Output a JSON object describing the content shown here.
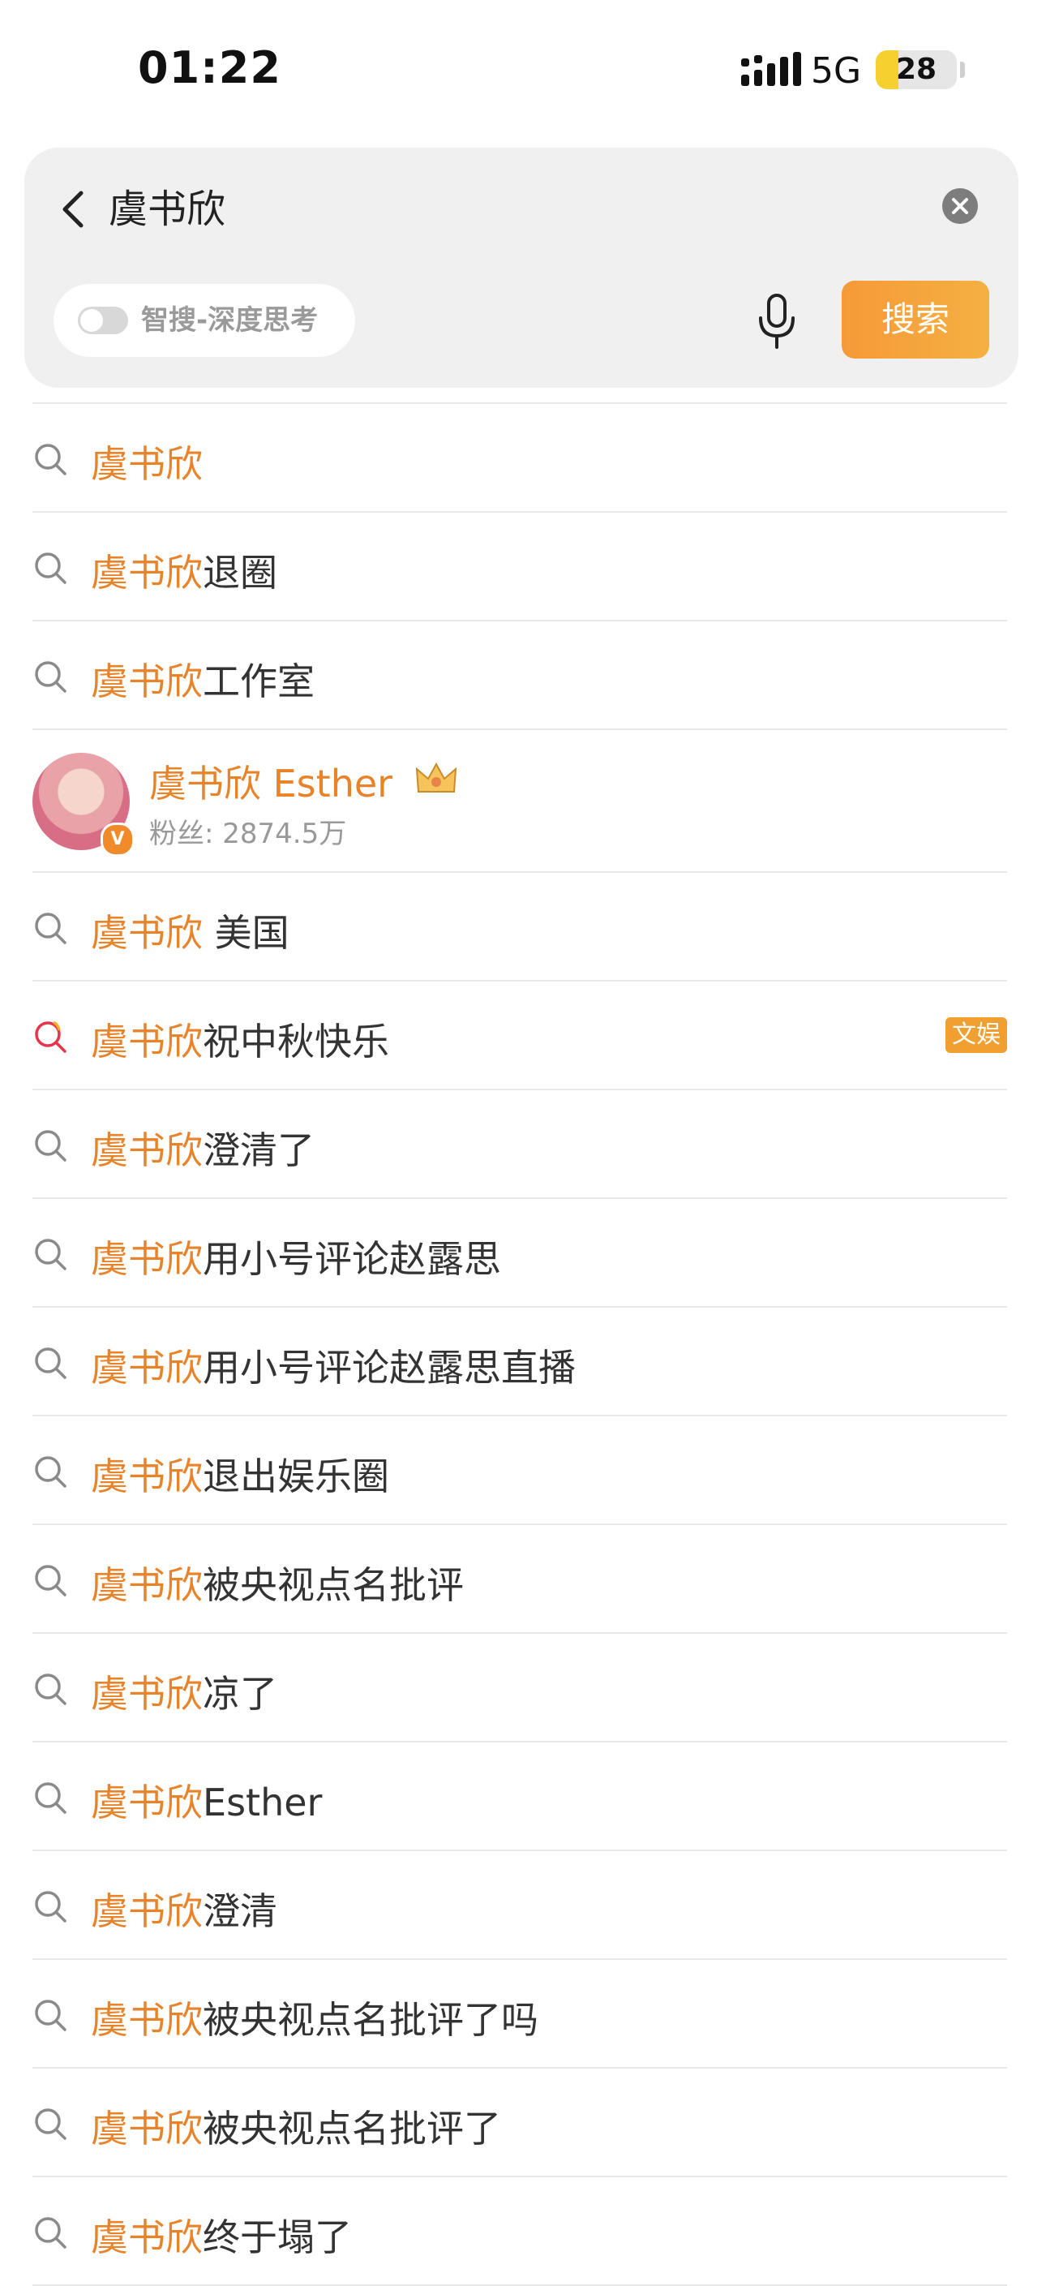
{
  "status_bar": {
    "time": "01:22",
    "network": "5G",
    "battery": "28",
    "battery_level": 0.28
  },
  "search": {
    "query": "虞书欣",
    "smart_toggle_label": "智搜-深度思考",
    "search_button": "搜索",
    "icons": {
      "back": "back-chevron-icon",
      "clear": "clear-icon",
      "mic": "microphone-icon"
    }
  },
  "suggestions": [
    {
      "prefix": "虞书欣",
      "suffix": "",
      "icon": "search-icon"
    },
    {
      "prefix": "虞书欣",
      "suffix": "退圈",
      "icon": "search-icon"
    },
    {
      "prefix": "虞书欣",
      "suffix": "工作室",
      "icon": "search-icon"
    },
    {
      "type": "user",
      "name": "虞书欣 Esther",
      "fans": "粉丝: 2874.5万",
      "verified": "V",
      "icon": "crown-icon"
    },
    {
      "prefix": "虞书欣",
      "suffix": " 美国",
      "icon": "search-icon"
    },
    {
      "prefix": "虞书欣",
      "suffix": "祝中秋快乐",
      "icon": "hot-search-icon",
      "badge": "文娱"
    },
    {
      "prefix": "虞书欣",
      "suffix": "澄清了",
      "icon": "search-icon"
    },
    {
      "prefix": "虞书欣",
      "suffix": "用小号评论赵露思",
      "icon": "search-icon"
    },
    {
      "prefix": "虞书欣",
      "suffix": "用小号评论赵露思直播",
      "icon": "search-icon"
    },
    {
      "prefix": "虞书欣",
      "suffix": "退出娱乐圈",
      "icon": "search-icon"
    },
    {
      "prefix": "虞书欣",
      "suffix": "被央视点名批评",
      "icon": "search-icon"
    },
    {
      "prefix": "虞书欣",
      "suffix": "凉了",
      "icon": "search-icon"
    },
    {
      "prefix": "虞书欣",
      "suffix": "Esther",
      "icon": "search-icon"
    },
    {
      "prefix": "虞书欣",
      "suffix": "澄清",
      "icon": "search-icon"
    },
    {
      "prefix": "虞书欣",
      "suffix": "被央视点名批评了吗",
      "icon": "search-icon"
    },
    {
      "prefix": "虞书欣",
      "suffix": "被央视点名批评了",
      "icon": "search-icon"
    },
    {
      "prefix": "虞书欣",
      "suffix": "终于塌了",
      "icon": "search-icon"
    }
  ],
  "colors": {
    "highlight": "#e8832a",
    "button": "#f5a03c",
    "badge": "#f0a030"
  }
}
